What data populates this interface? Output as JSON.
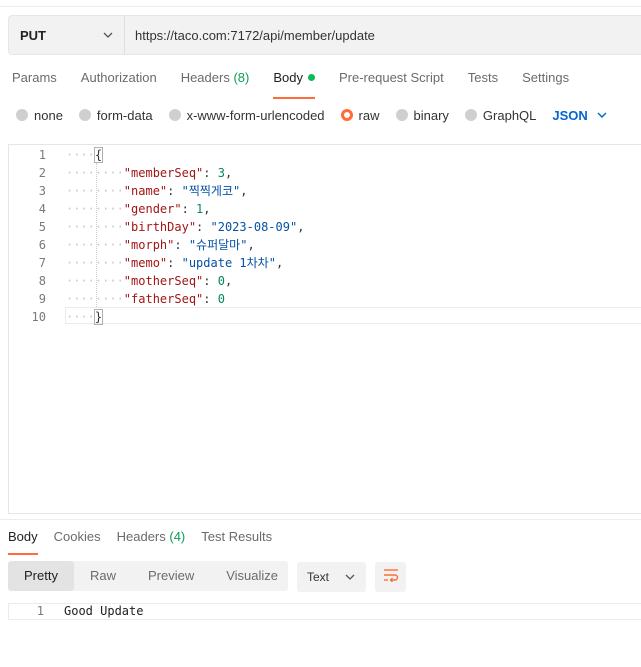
{
  "request": {
    "method": "PUT",
    "url": "https://taco.com:7172/api/member/update"
  },
  "request_tabs": [
    {
      "label": "Params"
    },
    {
      "label": "Authorization"
    },
    {
      "label": "Headers",
      "count": "(8)"
    },
    {
      "label": "Body",
      "active": true,
      "indicator": "green-dot"
    },
    {
      "label": "Pre-request Script"
    },
    {
      "label": "Tests"
    },
    {
      "label": "Settings"
    }
  ],
  "body_types": {
    "none": "none",
    "form_data": "form-data",
    "urlencoded": "x-www-form-urlencoded",
    "raw": "raw",
    "binary": "binary",
    "graphql": "GraphQL",
    "selected": "raw",
    "format": "JSON"
  },
  "editor": {
    "lines": [
      {
        "n": "1",
        "indent": 1,
        "text": "{"
      },
      {
        "n": "2",
        "indent": 2,
        "key": "\"memberSeq\"",
        "value": "3",
        "vtype": "num",
        "comma": true
      },
      {
        "n": "3",
        "indent": 2,
        "key": "\"name\"",
        "value": "\"찍찍게코\"",
        "vtype": "str",
        "comma": true
      },
      {
        "n": "4",
        "indent": 2,
        "key": "\"gender\"",
        "value": "1",
        "vtype": "num",
        "comma": true
      },
      {
        "n": "5",
        "indent": 2,
        "key": "\"birthDay\"",
        "value": "\"2023-08-09\"",
        "vtype": "str",
        "comma": true
      },
      {
        "n": "6",
        "indent": 2,
        "key": "\"morph\"",
        "value": "\"슈퍼달마\"",
        "vtype": "str",
        "comma": true
      },
      {
        "n": "7",
        "indent": 2,
        "key": "\"memo\"",
        "value": "\"update 1차차\"",
        "vtype": "str",
        "comma": true
      },
      {
        "n": "8",
        "indent": 2,
        "key": "\"motherSeq\"",
        "value": "0",
        "vtype": "num",
        "comma": true
      },
      {
        "n": "9",
        "indent": 2,
        "key": "\"fatherSeq\"",
        "value": "0",
        "vtype": "num",
        "comma": false
      },
      {
        "n": "10",
        "indent": 1,
        "text": "}"
      }
    ]
  },
  "response_tabs": [
    {
      "label": "Body",
      "active": true
    },
    {
      "label": "Cookies"
    },
    {
      "label": "Headers",
      "count": "(4)"
    },
    {
      "label": "Test Results"
    }
  ],
  "view_modes": [
    {
      "label": "Pretty",
      "active": true
    },
    {
      "label": "Raw"
    },
    {
      "label": "Preview"
    },
    {
      "label": "Visualize"
    }
  ],
  "response_format": "Text",
  "response": {
    "line_number": "1",
    "text": "Good Update"
  },
  "colors": {
    "accent": "#ff6c37",
    "link_blue": "#0265d2",
    "count_green": "#0f9d58",
    "dot_green": "#0cbb52"
  }
}
